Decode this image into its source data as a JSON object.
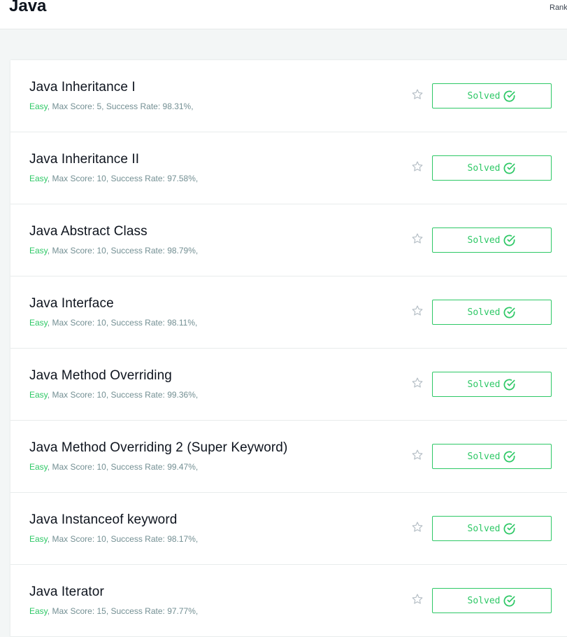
{
  "header": {
    "title": "Java",
    "rank_label": "Rank"
  },
  "colors": {
    "accent_green": "#2ec866",
    "meta_gray": "#738f93",
    "title_dark": "#0e141e",
    "background": "#f3f6f6"
  },
  "challenges": [
    {
      "title": "Java Inheritance I",
      "difficulty": "Easy",
      "meta": ", Max Score: 5, Success Rate: 98.31%,",
      "status": "Solved"
    },
    {
      "title": "Java Inheritance II",
      "difficulty": "Easy",
      "meta": ", Max Score: 10, Success Rate: 97.58%,",
      "status": "Solved"
    },
    {
      "title": "Java Abstract Class",
      "difficulty": "Easy",
      "meta": ", Max Score: 10, Success Rate: 98.79%,",
      "status": "Solved"
    },
    {
      "title": "Java Interface",
      "difficulty": "Easy",
      "meta": ", Max Score: 10, Success Rate: 98.11%,",
      "status": "Solved"
    },
    {
      "title": "Java Method Overriding",
      "difficulty": "Easy",
      "meta": ", Max Score: 10, Success Rate: 99.36%,",
      "status": "Solved"
    },
    {
      "title": "Java Method Overriding 2 (Super Keyword)",
      "difficulty": "Easy",
      "meta": ", Max Score: 10, Success Rate: 99.47%,",
      "status": "Solved"
    },
    {
      "title": "Java Instanceof keyword",
      "difficulty": "Easy",
      "meta": ", Max Score: 10, Success Rate: 98.17%,",
      "status": "Solved"
    },
    {
      "title": "Java Iterator",
      "difficulty": "Easy",
      "meta": ", Max Score: 15, Success Rate: 97.77%,",
      "status": "Solved"
    }
  ]
}
